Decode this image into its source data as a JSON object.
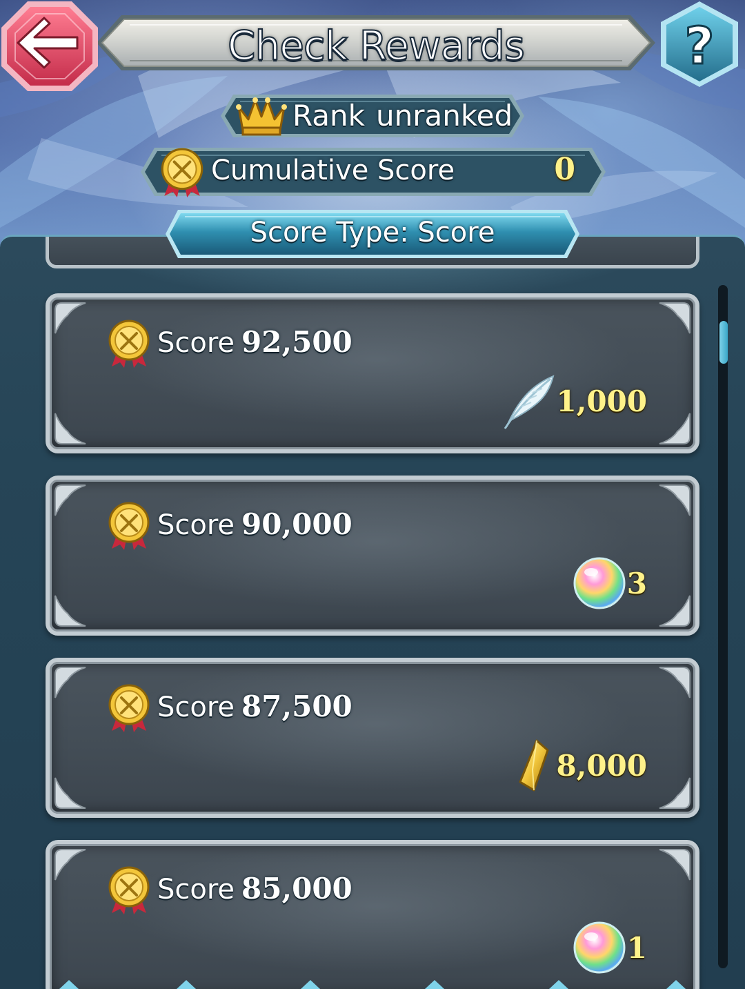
{
  "header": {
    "title": "Check Rewards",
    "back_icon": "back-arrow-icon",
    "help_icon": "question-mark-icon"
  },
  "rank": {
    "label": "Rank",
    "value": "unranked",
    "icon": "crown-icon"
  },
  "cumulative": {
    "label": "Cumulative Score",
    "value": "0",
    "icon": "score-medal-icon"
  },
  "score_type": {
    "label": "Score Type: Score"
  },
  "rewards": [
    {
      "score_label": "Score",
      "score_value": "92,500",
      "reward_icon": "feather-icon",
      "quantity": "1,000"
    },
    {
      "score_label": "Score",
      "score_value": "90,000",
      "reward_icon": "orb-icon",
      "quantity": "3"
    },
    {
      "score_label": "Score",
      "score_value": "87,500",
      "reward_icon": "crystal-icon",
      "quantity": "8,000"
    },
    {
      "score_label": "Score",
      "score_value": "85,000",
      "reward_icon": "orb-icon",
      "quantity": "1"
    }
  ],
  "colors": {
    "accent_gold": "#fff28a",
    "panel_teal": "#264557",
    "back_button_red": "#e0506a",
    "help_button_teal": "#3b8fae"
  }
}
